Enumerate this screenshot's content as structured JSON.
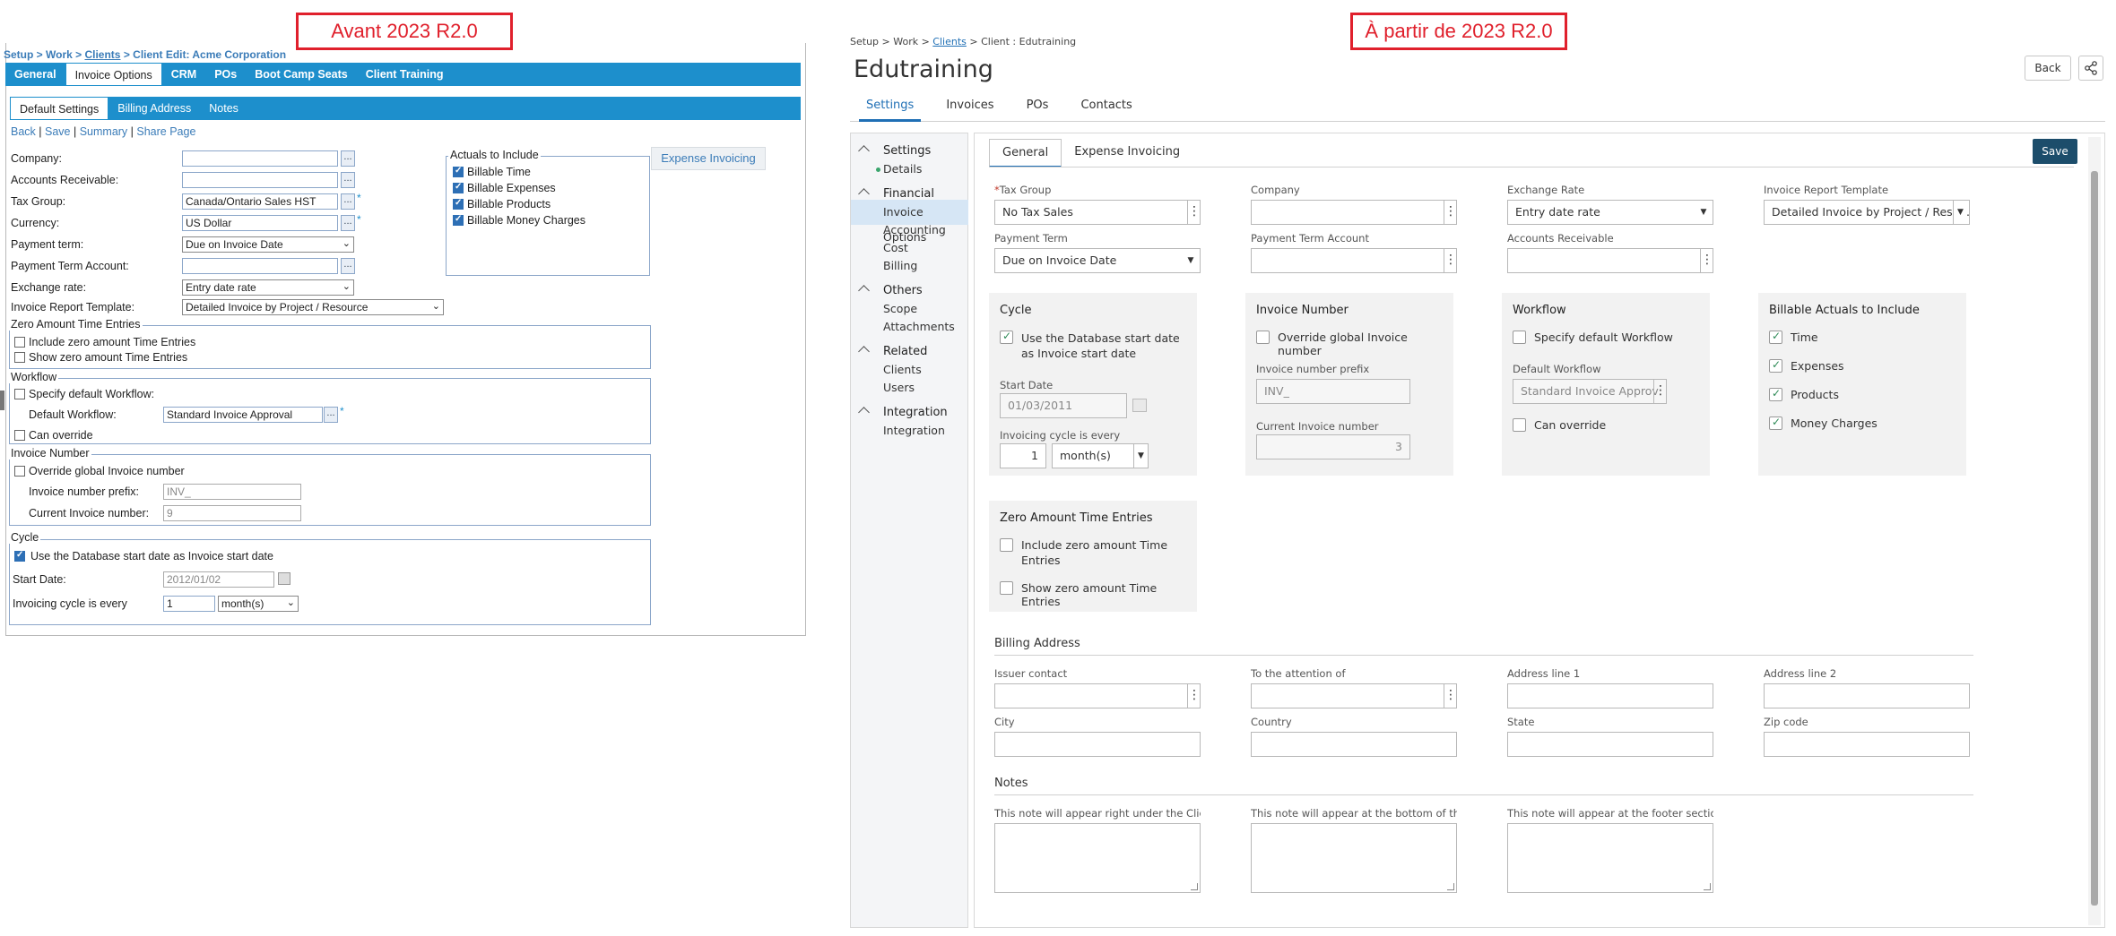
{
  "captions": {
    "before": "Avant 2023 R2.0",
    "after": "À partir de 2023 R2.0"
  },
  "old": {
    "breadcrumb": {
      "prefix": "Setup > Work > ",
      "clients": "Clients",
      "suffix": " > Client Edit: Acme Corporation"
    },
    "tabs": [
      "General",
      "Invoice Options",
      "CRM",
      "POs",
      "Boot Camp Seats",
      "Client Training"
    ],
    "subtabs": [
      "Default Settings",
      "Billing Address",
      "Notes"
    ],
    "links": {
      "back": "Back",
      "save": "Save",
      "summary": "Summary",
      "share": "Share Page",
      "sep": " | "
    },
    "fields": {
      "company": {
        "label": "Company:",
        "value": ""
      },
      "ar": {
        "label": "Accounts Receivable:",
        "value": ""
      },
      "tax_group": {
        "label": "Tax Group:",
        "value": "Canada/Ontario Sales HST"
      },
      "currency": {
        "label": "Currency:",
        "value": "US Dollar"
      },
      "payment_term": {
        "label": "Payment term:",
        "value": "Due on Invoice Date"
      },
      "payment_term_account": {
        "label": "Payment Term Account:",
        "value": ""
      },
      "exchange_rate": {
        "label": "Exchange rate:",
        "value": "Entry date rate"
      },
      "report_template": {
        "label": "Invoice Report Template:",
        "value": "Detailed Invoice by Project / Resource"
      }
    },
    "dots": "...",
    "req": "*",
    "actuals": {
      "legend": "Actuals to Include",
      "items": [
        "Billable Time",
        "Billable Expenses",
        "Billable Products",
        "Billable Money Charges"
      ]
    },
    "expense_button": "Expense Invoicing",
    "zero": {
      "legend": "Zero Amount Time Entries",
      "include": "Include zero amount Time Entries",
      "show": "Show zero amount Time Entries"
    },
    "workflow": {
      "legend": "Workflow",
      "specify": "Specify default Workflow:",
      "default_label": "Default Workflow:",
      "default_value": "Standard Invoice Approval",
      "override": "Can override"
    },
    "invoice_number": {
      "legend": "Invoice Number",
      "override": "Override global Invoice number",
      "prefix_label": "Invoice number prefix:",
      "prefix_value": "INV_",
      "current_label": "Current Invoice number:",
      "current_value": "9"
    },
    "cycle": {
      "legend": "Cycle",
      "use_db": "Use the Database start date as Invoice start date",
      "start_label": "Start Date:",
      "start_value": "2012/01/02",
      "every_label": "Invoicing cycle is every",
      "every_value": "1",
      "unit": "month(s)"
    }
  },
  "new": {
    "breadcrumb": {
      "prefix": "Setup > Work > ",
      "clients": "Clients",
      "suffix": " > Client : Edutraining"
    },
    "title": "Edutraining",
    "back": "Back",
    "tabs": [
      "Settings",
      "Invoices",
      "POs",
      "Contacts"
    ],
    "sidebar": {
      "settings": {
        "title": "Settings",
        "items": [
          "Details"
        ]
      },
      "financial": {
        "title": "Financial",
        "items": [
          "Invoice Options",
          "Accounting",
          "Cost",
          "Billing"
        ]
      },
      "others": {
        "title": "Others",
        "items": [
          "Scope",
          "Attachments"
        ]
      },
      "related": {
        "title": "Related",
        "items": [
          "Clients",
          "Users"
        ]
      },
      "integration": {
        "title": "Integration",
        "items": [
          "Integration"
        ]
      }
    },
    "subtabs": [
      "General",
      "Expense Invoicing"
    ],
    "save": "Save",
    "fields": {
      "tax_group": {
        "label": "Tax Group",
        "req": "*",
        "value": "No Tax Sales"
      },
      "company": {
        "label": "Company",
        "value": ""
      },
      "exchange_rate": {
        "label": "Exchange Rate",
        "value": "Entry date rate"
      },
      "report_template": {
        "label": "Invoice Report Template",
        "value": "Detailed Invoice by Project / Reso..."
      },
      "payment_term": {
        "label": "Payment Term",
        "value": "Due on Invoice Date"
      },
      "payment_term_account": {
        "label": "Payment Term Account",
        "value": ""
      },
      "ar": {
        "label": "Accounts Receivable",
        "value": ""
      }
    },
    "cycle": {
      "title": "Cycle",
      "use_db": "Use the Database start date as Invoice start date",
      "start_label": "Start Date",
      "start_value": "01/03/2011",
      "every_label": "Invoicing cycle is every",
      "every_value": "1",
      "unit": "month(s)"
    },
    "invoice_number": {
      "title": "Invoice Number",
      "override": "Override global Invoice number",
      "prefix_label": "Invoice number prefix",
      "prefix_value": "INV_",
      "current_label": "Current Invoice number",
      "current_value": "3"
    },
    "workflow": {
      "title": "Workflow",
      "specify": "Specify default Workflow",
      "default_label": "Default Workflow",
      "default_value": "Standard Invoice Approv",
      "override": "Can override"
    },
    "actuals": {
      "title": "Billable Actuals to Include",
      "items": [
        "Time",
        "Expenses",
        "Products",
        "Money Charges"
      ]
    },
    "zero": {
      "title": "Zero Amount Time Entries",
      "include_line1": "Include zero amount Time",
      "include_line2": "Entries",
      "show": "Show zero amount Time Entries"
    },
    "billing": {
      "title": "Billing Address",
      "row1": [
        "Issuer contact",
        "To the attention of",
        "Address line 1",
        "Address line 2"
      ],
      "row2": [
        "City",
        "Country",
        "State",
        "Zip code"
      ]
    },
    "notes": {
      "title": "Notes",
      "placeholders": [
        "This note will appear right under the Clien...",
        "This note will appear at the bottom of the ...",
        "This note will appear at the footer section ..."
      ]
    }
  }
}
